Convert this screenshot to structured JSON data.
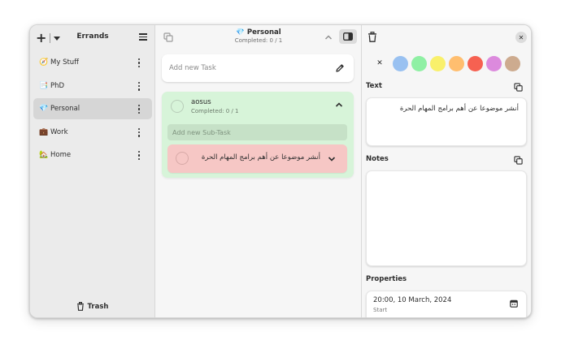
{
  "sidebar": {
    "title": "Errands",
    "lists": [
      {
        "emoji": "🧭",
        "label": "My Stuff",
        "active": false
      },
      {
        "emoji": "📑",
        "label": "PhD",
        "active": false
      },
      {
        "emoji": "💎",
        "label": "Personal",
        "active": true
      },
      {
        "emoji": "💼",
        "label": "Work",
        "active": false
      },
      {
        "emoji": "🏡",
        "label": "Home",
        "active": false
      }
    ],
    "trash_label": "Trash"
  },
  "middle": {
    "title_emoji": "💎",
    "title": "Personal",
    "subtitle": "Completed: 0 / 1",
    "add_task_placeholder": "Add new Task",
    "task": {
      "name": "aosus",
      "completed": "Completed: 0 / 1",
      "color": "#d7f4d9",
      "add_subtask_placeholder": "Add new Sub-Task",
      "subtask": {
        "text": "أنشر موضوعا عن أهم برامج المهام الحرة",
        "color": "#f6c7c5"
      }
    }
  },
  "details": {
    "colors": [
      "#99c1f1",
      "#8ff0a4",
      "#f9f06b",
      "#ffbe6f",
      "#f66151",
      "#dc8add",
      "#cdab8f"
    ],
    "text_label": "Text",
    "text_value": "أنشر موضوعا عن أهم برامج المهام الحرة",
    "notes_label": "Notes",
    "notes_value": "",
    "properties_label": "Properties",
    "start_date": "20:00, 10 March, 2024",
    "start_label": "Start"
  }
}
